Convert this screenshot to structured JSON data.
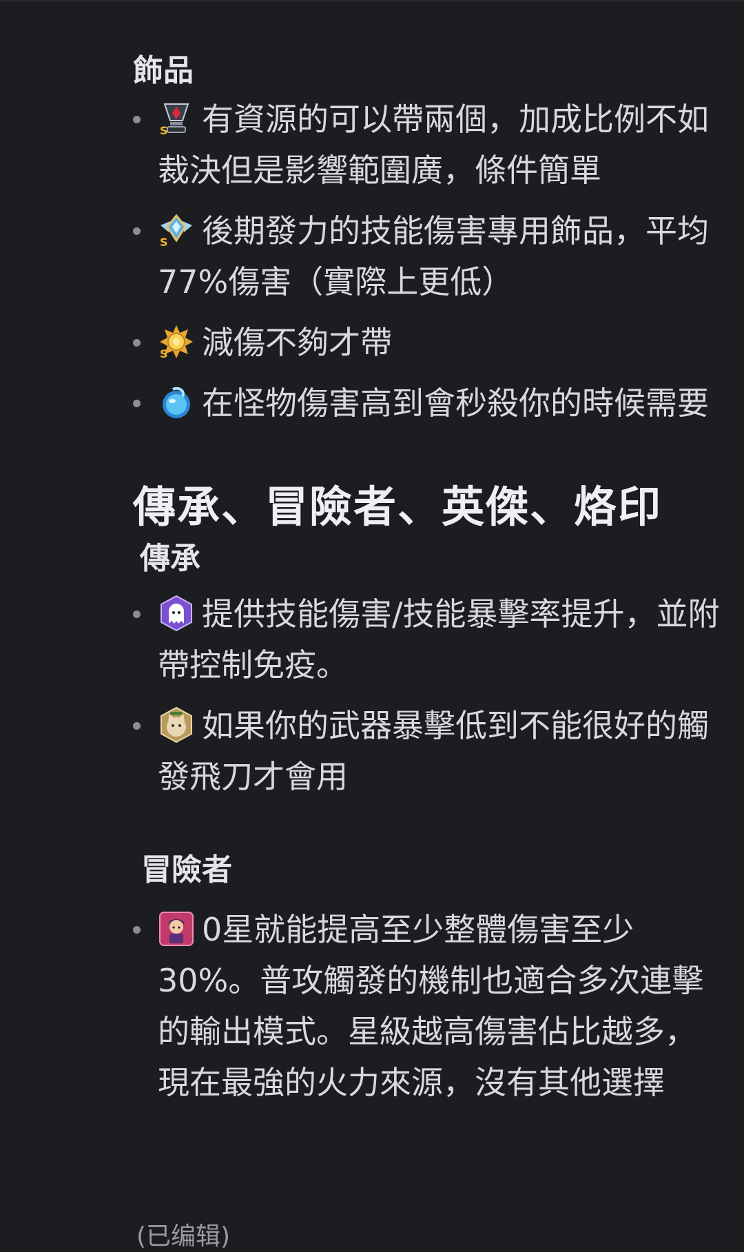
{
  "sections": {
    "accessories": {
      "heading": "飾品",
      "items": [
        {
          "icon": "red-gem-trophy-s-icon",
          "text": "有資源的可以帶兩個，加成比例不如裁決但是影響範圍廣，條件簡單"
        },
        {
          "icon": "winged-crystal-emblem-s-icon",
          "text": "後期發力的技能傷害專用飾品，平均77%傷害（實際上更低）"
        },
        {
          "icon": "golden-sun-badge-s-icon",
          "text": "減傷不夠才帶"
        },
        {
          "icon": "blue-spirit-orb-icon",
          "text": "在怪物傷害高到會秒殺你的時候需要"
        }
      ]
    },
    "main_heading": "傳承、冒險者、英傑、烙印",
    "legacy": {
      "heading": "傳承",
      "items": [
        {
          "icon": "ghost-hexagon-icon",
          "text": "提供技能傷害/技能暴擊率提升，並附帶控制免疫。"
        },
        {
          "icon": "cat-hexagon-icon",
          "text": "如果你的武器暴擊低到不能很好的觸發飛刀才會用"
        }
      ]
    },
    "adventurer": {
      "heading": "冒險者",
      "items": [
        {
          "icon": "adventurer-portrait-icon",
          "text": "0星就能提高至少整體傷害至少30%。普攻觸發的機制也適合多次連擊的輸出模式。星級越高傷害佔比越多，現在最強的火力來源，沒有其他選擇"
        }
      ]
    }
  },
  "footer": {
    "edited_label": "(已编辑)"
  },
  "colors": {
    "background": "#1c1d21",
    "text": "#d8d9dd",
    "bullet": "#8d8e94"
  }
}
